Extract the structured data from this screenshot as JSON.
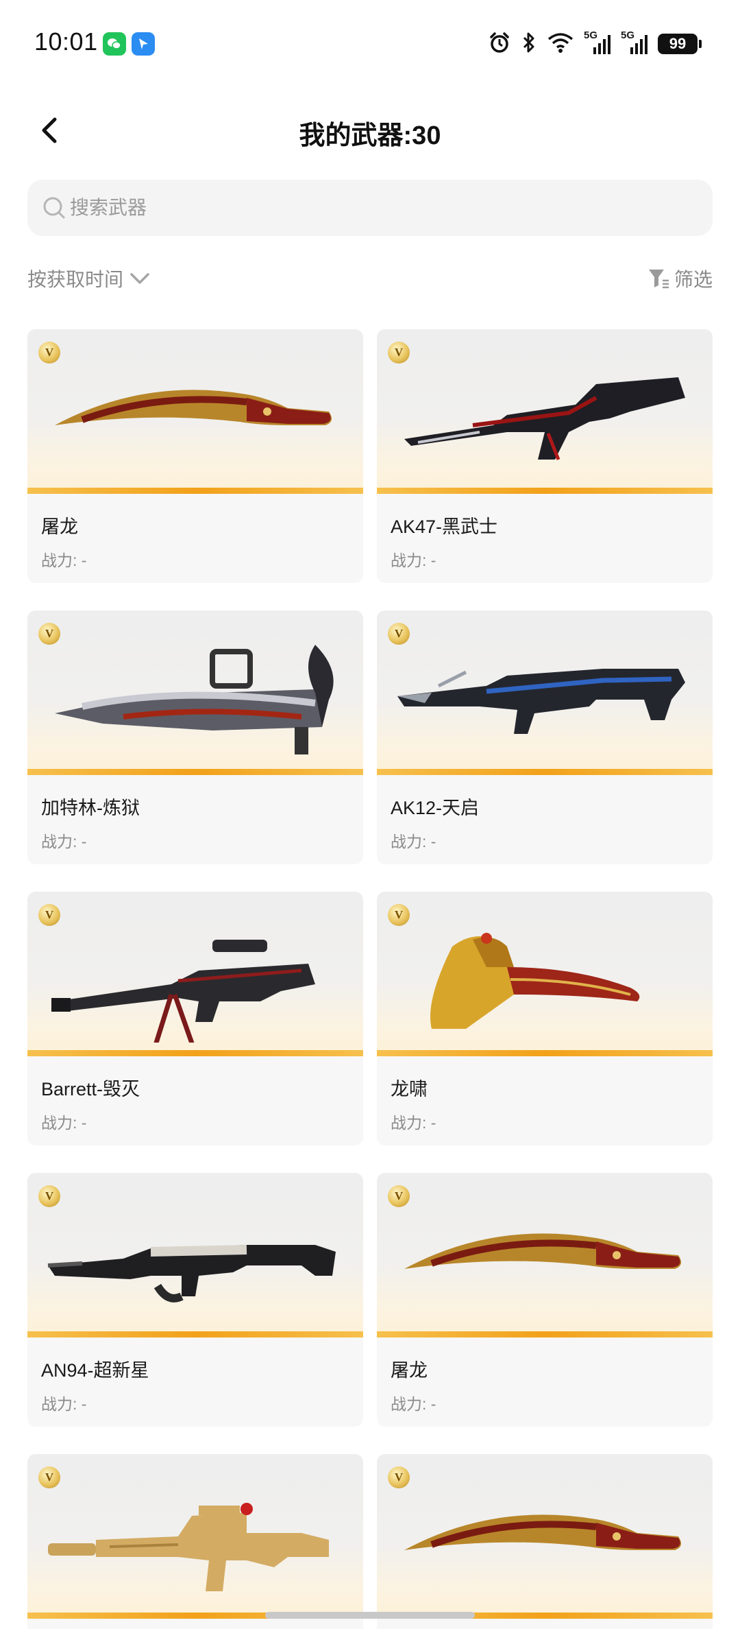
{
  "status_bar": {
    "time": "10:01",
    "battery": "99",
    "icons": [
      "wechat-icon",
      "navigation-app-icon",
      "alarm-icon",
      "bluetooth-icon",
      "wifi-icon",
      "signal-5g-icon",
      "signal-5g-icon",
      "battery-icon"
    ],
    "network_label_1": "5G",
    "network_label_2": "5G"
  },
  "header": {
    "title": "我的武器:30"
  },
  "search": {
    "placeholder": "搜索武器",
    "value": ""
  },
  "toolbar": {
    "sort_label": "按获取时间",
    "filter_label": "筛选"
  },
  "weapons": [
    {
      "name": "屠龙",
      "power": "战力: -",
      "badge": "V",
      "art": "kukri-knife"
    },
    {
      "name": "AK47-黑武士",
      "power": "战力: -",
      "badge": "V",
      "art": "rifle-dark"
    },
    {
      "name": "加特林-炼狱",
      "power": "战力: -",
      "badge": "V",
      "art": "gatling"
    },
    {
      "name": "AK12-天启",
      "power": "战力: -",
      "badge": "V",
      "art": "rifle-blue"
    },
    {
      "name": "Barrett-毁灭",
      "power": "战力: -",
      "badge": "V",
      "art": "sniper"
    },
    {
      "name": "龙啸",
      "power": "战力: -",
      "badge": "V",
      "art": "axe-gold"
    },
    {
      "name": "AN94-超新星",
      "power": "战力: -",
      "badge": "V",
      "art": "rifle-silver"
    },
    {
      "name": "屠龙",
      "power": "战力: -",
      "badge": "V",
      "art": "kukri-knife"
    },
    {
      "name": "",
      "power": "",
      "badge": "V",
      "art": "m4-gold"
    },
    {
      "name": "",
      "power": "",
      "badge": "V",
      "art": "kukri-knife"
    }
  ],
  "colors": {
    "accent_stripe": "#f2a11a",
    "card_bg": "#f7f7f7",
    "muted_text": "#8a8a8a"
  }
}
